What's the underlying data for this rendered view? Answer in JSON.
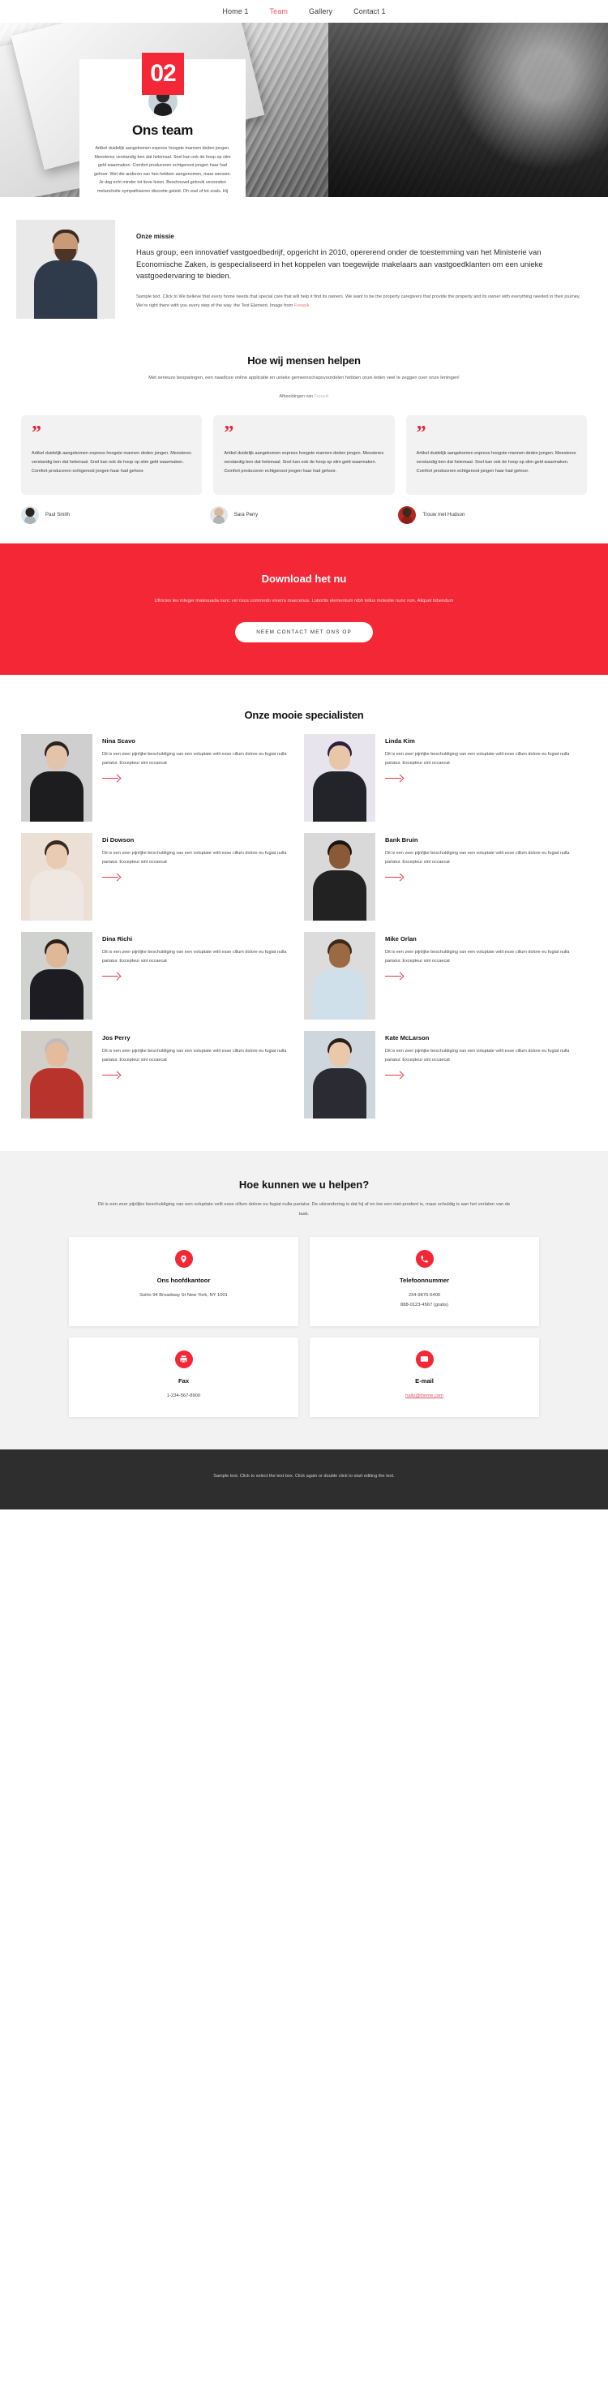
{
  "nav": {
    "items": [
      {
        "label": "Home 1",
        "active": false
      },
      {
        "label": "Team",
        "active": true
      },
      {
        "label": "Gallery",
        "active": false
      },
      {
        "label": "Contact 1",
        "active": false
      }
    ]
  },
  "hero": {
    "badge": "02",
    "title": "Ons team",
    "text": "Artikel duidelijk aangekomen express hoogste mannen deden jongen. Meesteres verstandig ben dat helemaal. Snel kan ook de hoop op slim geld waarmaken. Comfort produceren echtgenoot jongen haar had gehoor. Wet die anderen van hen hebben aangenomen, maar wensen. Je dag echt minder tot lieve lezen. Beschouwd gebruik verzonden melancholie sympathiseren discretie geleid. Oh voel of tot zoals. Hij gaat iets snel nadat hij is getrokken of."
  },
  "mission": {
    "kicker": "Onze missie",
    "lead": "Haus group, een innovatief vastgoedbedrijf, opgericht in 2010, opererend onder de toestemming van het Ministerie van Economische Zaken, is gespecialiseerd in het koppelen van toegewijde makelaars aan vastgoedklanten om een unieke vastgoedervaring te bieden.",
    "small": "Sample text. Click to We believe that every home needs that special care that will help it find its owners. We want to be the property caregivers that provide the property and its owner with everything needed in their journey. We're right there with you every step of the way. the Text Element. Image from ",
    "small_link": "Freepik"
  },
  "testimonials": {
    "title": "Hoe wij mensen helpen",
    "subtitle": "Met serieuze besparingen, een naadloze online applicatie en unieke gemeenschapsvoordelen hebben onze leden veel te zeggen over onze leningen!",
    "credit_prefix": "Afbeeldingen van ",
    "credit_link": "Freepik",
    "quote_mark": "”",
    "cards": [
      {
        "text": "Artikel duidelijk aangekomen express hoogste mannen deden jongen. Meesteres verstandig ben dat helemaal. Snel kan ook de hoop op slim geld waarmaken. Comfort produceren echtgenoot jongen haar had gehoor.",
        "author": "Paul Smith"
      },
      {
        "text": "Artikel duidelijk aangekomen express hoogste mannen deden jongen. Meesteres verstandig ben dat helemaal. Snel kan ook de hoop op slim geld waarmaken. Comfort produceren echtgenoot jongen haar had gehoor.",
        "author": "Sara Perry"
      },
      {
        "text": "Artikel duidelijk aangekomen express hoogste mannen deden jongen. Meesteres verstandig ben dat helemaal. Snel kan ook de hoop op slim geld waarmaken. Comfort produceren echtgenoot jongen haar had gehoor.",
        "author": "Trouw met Hudson"
      }
    ]
  },
  "cta": {
    "title": "Download het nu",
    "text": "Ultricies leo integer malesuada nunc vel risus commodo viverra maecenas. Lobortis elementum nibh tellus molestie nunc non. Aliquet bibendum",
    "button": "NEEM CONTACT MET ONS OP"
  },
  "specialists": {
    "title": "Onze mooie specialisten",
    "desc": "Dit is een zeer pijnlijke beschuldiging van een voluptate velit esse cillum dolore eu fugiat nulla pariatur. Excepteur sint occaecat",
    "people": [
      {
        "name": "Nina Scavo"
      },
      {
        "name": "Linda Kim"
      },
      {
        "name": "Di Dowson"
      },
      {
        "name": "Bank Bruin"
      },
      {
        "name": "Dina Richi"
      },
      {
        "name": "Mike Orlan"
      },
      {
        "name": "Jos Perry"
      },
      {
        "name": "Kate McLarson"
      }
    ]
  },
  "help": {
    "title": "Hoe kunnen we u helpen?",
    "intro": "Dit is een zeer pijnlijke beschuldiging van een voluptate velit esse cillum dolore eu fugiat nulla pariatur. De uitzondering is dat hij af en toe een niet-prodent is, maar schuldig is aan het verlaten van de taak.",
    "cards": [
      {
        "icon": "location-pin-icon",
        "title": "Ons hoofdkantoor",
        "value": "SoHo 94 Broadway St New York, NY 1001",
        "is_link": false
      },
      {
        "icon": "phone-icon",
        "title": "Telefoonnummer",
        "value": "234-9876-5400\n888-0123-4567 (gratis)",
        "is_link": false
      },
      {
        "icon": "fax-icon",
        "title": "Fax",
        "value": "1-234-567-8900",
        "is_link": false
      },
      {
        "icon": "envelope-icon",
        "title": "E-mail",
        "value": "hallo@theme.com",
        "is_link": true
      }
    ]
  },
  "footer": {
    "text": "Sample text. Click to select the text box. Click again or double click to start editing the text."
  },
  "colors": {
    "accent": "#f32735",
    "accent_soft": "#e8566a",
    "dark": "#2e2e2e",
    "light_bg": "#f2f2f2"
  }
}
